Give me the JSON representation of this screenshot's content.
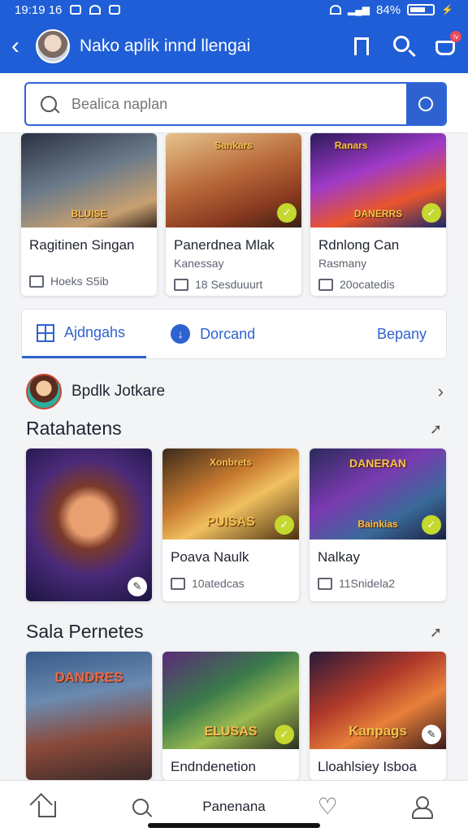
{
  "status_bar": {
    "time": "19:19 16",
    "battery": "84%"
  },
  "app_bar": {
    "title": "Nako aplik innd llengai",
    "badge": "!v"
  },
  "search": {
    "placeholder": "Bealica naplan"
  },
  "top_cards": [
    {
      "title": "Ragitinen Singan",
      "subtitle": "",
      "meta": "Hoeks S5ib",
      "image_label": "BLUISE"
    },
    {
      "title": "Panerdnea Mlak",
      "subtitle": "Kanessay",
      "meta": "18 Sesduuurt",
      "image_label": "Sankars"
    },
    {
      "title": "Rdnlong Can",
      "subtitle": "Rasmany",
      "meta": "20ocatedis",
      "image_label": "DANERRS"
    }
  ],
  "filters": [
    {
      "label": "Ajdngahs",
      "icon": "grid-icon"
    },
    {
      "label": "Dorcand",
      "icon": "download-badge-icon"
    },
    {
      "label": "Bepany"
    }
  ],
  "profile": {
    "name": "Bpdlk Jotkare"
  },
  "section1": {
    "title": "Ratahatens",
    "cards": [
      {
        "title": "",
        "meta": "",
        "image_label": ""
      },
      {
        "title": "Poava Naulk",
        "meta": "10atedcas",
        "image_label": "PUISAS"
      },
      {
        "title": "Nalkay",
        "meta": "11Snidela2",
        "image_label": "DANERAN"
      }
    ]
  },
  "section2": {
    "title": "Sala Pernetes",
    "cards": [
      {
        "title": "",
        "image_label": "DANDRES"
      },
      {
        "title": "Endndenetion",
        "image_label": "ELUSAS"
      },
      {
        "title": "Lloahlsiey Isboa",
        "image_label": "Kanpags"
      }
    ]
  },
  "bottom_nav": {
    "center_label": "Panenana"
  }
}
